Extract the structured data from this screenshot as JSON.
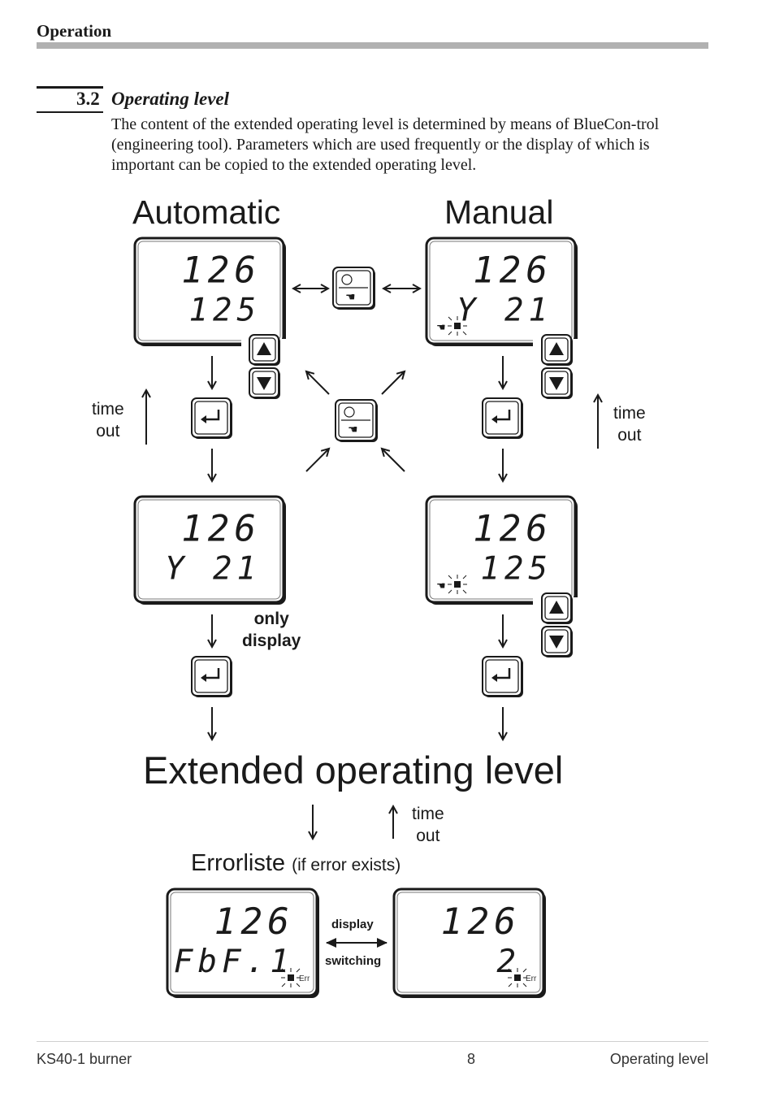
{
  "header": {
    "title": "Operation"
  },
  "section": {
    "number": "3.2",
    "title": "Operating level",
    "body": "The content of the extended operating level is determined by means of BlueCon-trol (engineering tool). Parameters which are used frequently or the display of which is important can be copied to the extended operating level."
  },
  "diagram": {
    "automatic_label": "Automatic",
    "manual_label": "Manual",
    "extended_label": "Extended operating level",
    "errorlist_label": "Errorliste",
    "errorlist_note": "(if error exists)",
    "time_out_line1": "time",
    "time_out_line2": "out",
    "only_display_line1": "only",
    "only_display_line2": "display",
    "display_switching_line1": "display",
    "display_switching_line2": "switching",
    "err_label": "Err",
    "displays": {
      "auto_top": {
        "line1": "126",
        "line2": "125",
        "indicator": false
      },
      "manual_top": {
        "line1": "126",
        "line2": "Y 21",
        "indicator": true
      },
      "auto_mid": {
        "line1": "126",
        "line2": "Y 21",
        "indicator": false
      },
      "manual_mid": {
        "line1": "126",
        "line2": "125",
        "indicator": true
      },
      "err_left": {
        "line1": "126",
        "line2": "FbF.1",
        "indicator": "err"
      },
      "err_right": {
        "line1": "126",
        "line2": "2",
        "indicator": "err"
      }
    },
    "icons": [
      "auto-manual-key-icon",
      "enter-key-icon",
      "up-key-icon",
      "down-key-icon",
      "hand-icon",
      "blinking-led-icon"
    ]
  },
  "footer": {
    "left": "KS40-1 burner",
    "page": "8",
    "right": "Operating level"
  }
}
